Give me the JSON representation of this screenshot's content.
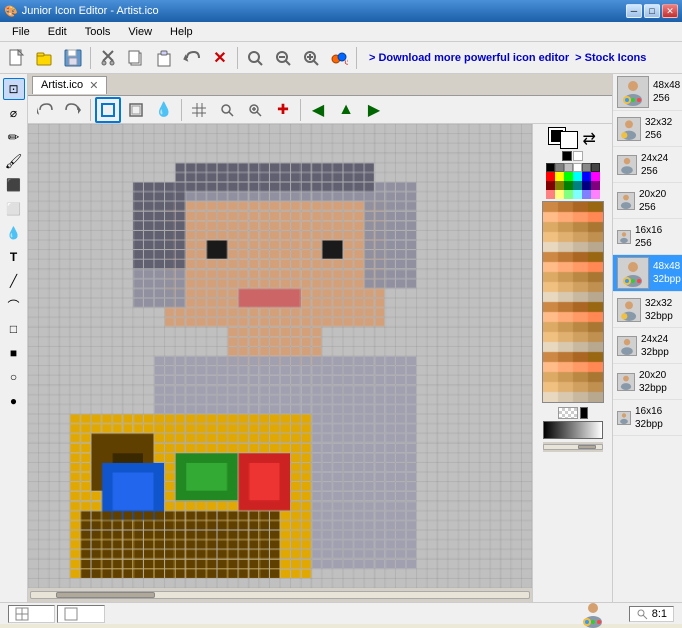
{
  "app": {
    "title": "Junior Icon Editor - Artist.ico",
    "icon": "🎨"
  },
  "title_controls": {
    "minimize": "─",
    "maximize": "□",
    "close": "✕"
  },
  "menu": {
    "items": [
      "File",
      "Edit",
      "Tools",
      "View",
      "Help"
    ]
  },
  "toolbar": {
    "buttons": [
      {
        "name": "new",
        "icon": "🆕",
        "unicode": "◻"
      },
      {
        "name": "open",
        "icon": "📂",
        "unicode": "📂"
      },
      {
        "name": "save",
        "icon": "💾",
        "unicode": "◼"
      },
      {
        "name": "cut",
        "icon": "✂",
        "unicode": "✂"
      },
      {
        "name": "copy",
        "icon": "📋",
        "unicode": "⧉"
      },
      {
        "name": "paste",
        "icon": "📌",
        "unicode": "⎘"
      },
      {
        "name": "undo-icon",
        "unicode": "↶"
      },
      {
        "name": "delete",
        "unicode": "✕"
      },
      {
        "name": "find",
        "unicode": "🔍"
      },
      {
        "name": "zoom-out",
        "unicode": "🔍"
      },
      {
        "name": "zoom-in",
        "unicode": "+"
      },
      {
        "name": "select",
        "unicode": "⊹"
      }
    ],
    "link1": "> Download more powerful icon editor",
    "link2": "> Stock Icons"
  },
  "doc_tab": {
    "name": "Artist.ico",
    "close": "✕"
  },
  "editor_toolbar": {
    "buttons": [
      {
        "name": "select-tool",
        "unicode": "↩"
      },
      {
        "name": "redo-tool",
        "unicode": "↪"
      },
      {
        "name": "image-size",
        "unicode": "⊡"
      },
      {
        "name": "image-size2",
        "unicode": "⊟"
      },
      {
        "name": "water-drop",
        "unicode": "💧"
      },
      {
        "name": "grid-toggle",
        "unicode": "⊞"
      },
      {
        "name": "zoom-search",
        "unicode": "🔍"
      },
      {
        "name": "zoom-real",
        "unicode": "⊕"
      },
      {
        "name": "color-pick",
        "unicode": "✚"
      },
      {
        "name": "nav-left",
        "unicode": "◀"
      },
      {
        "name": "nav-up",
        "unicode": "▲"
      },
      {
        "name": "nav-right",
        "unicode": "▶"
      }
    ]
  },
  "left_tools": [
    {
      "name": "select-rect",
      "unicode": "⊡"
    },
    {
      "name": "select-lasso",
      "unicode": "⌀"
    },
    {
      "name": "pencil",
      "unicode": "✏"
    },
    {
      "name": "brush",
      "unicode": "🖌"
    },
    {
      "name": "fill",
      "unicode": "⬛"
    },
    {
      "name": "eraser",
      "unicode": "⬜"
    },
    {
      "name": "dropper",
      "unicode": "💧"
    },
    {
      "name": "text",
      "unicode": "T"
    },
    {
      "name": "line",
      "unicode": "╱"
    },
    {
      "name": "curve",
      "unicode": "⌒"
    },
    {
      "name": "rect-outline",
      "unicode": "□"
    },
    {
      "name": "rect-fill",
      "unicode": "■"
    },
    {
      "name": "ellipse-outline",
      "unicode": "○"
    },
    {
      "name": "ellipse-fill",
      "unicode": "●"
    }
  ],
  "color_palette": {
    "rows": [
      [
        "#000000",
        "#808080",
        "#800000",
        "#808000",
        "#008000",
        "#008080",
        "#000080",
        "#800080"
      ],
      [
        "#ffffff",
        "#c0c0c0",
        "#ff0000",
        "#ffff00",
        "#00ff00",
        "#00ffff",
        "#0000ff",
        "#ff00ff"
      ],
      [
        "#404040",
        "#606060",
        "#8b0000",
        "#8b8b00",
        "#006400",
        "#008b8b",
        "#00008b",
        "#8b008b"
      ],
      [
        "#202020",
        "#a0a0a0",
        "#ff6666",
        "#ffff88",
        "#66ff66",
        "#66ffff",
        "#6666ff",
        "#ff66ff"
      ]
    ],
    "extended_browns": true
  },
  "icon_sizes": [
    {
      "label": "48x48\n256",
      "selected": false,
      "size": "48x48",
      "depth": "256"
    },
    {
      "label": "32x32\n256",
      "selected": false,
      "size": "32x32",
      "depth": "256"
    },
    {
      "label": "24x24\n256",
      "selected": false,
      "size": "24x24",
      "depth": "256"
    },
    {
      "label": "20x20\n256",
      "selected": false,
      "size": "20x20",
      "depth": "256"
    },
    {
      "label": "16x16\n256",
      "selected": false,
      "size": "16x16",
      "depth": "256"
    },
    {
      "label": "48x48\n32bpp",
      "selected": true,
      "size": "48x48",
      "depth": "32bpp"
    },
    {
      "label": "32x32\n32bpp",
      "selected": false,
      "size": "32x32",
      "depth": "32bpp"
    },
    {
      "label": "24x24\n32bpp",
      "selected": false,
      "size": "24x24",
      "depth": "32bpp"
    },
    {
      "label": "20x20\n32bpp",
      "selected": false,
      "size": "20x20",
      "depth": "32bpp"
    },
    {
      "label": "16x16\n32bpp",
      "selected": false,
      "size": "16x16",
      "depth": "32bpp"
    }
  ],
  "status_bar": {
    "coords1": "",
    "coords2": "",
    "zoom": "8:1"
  }
}
